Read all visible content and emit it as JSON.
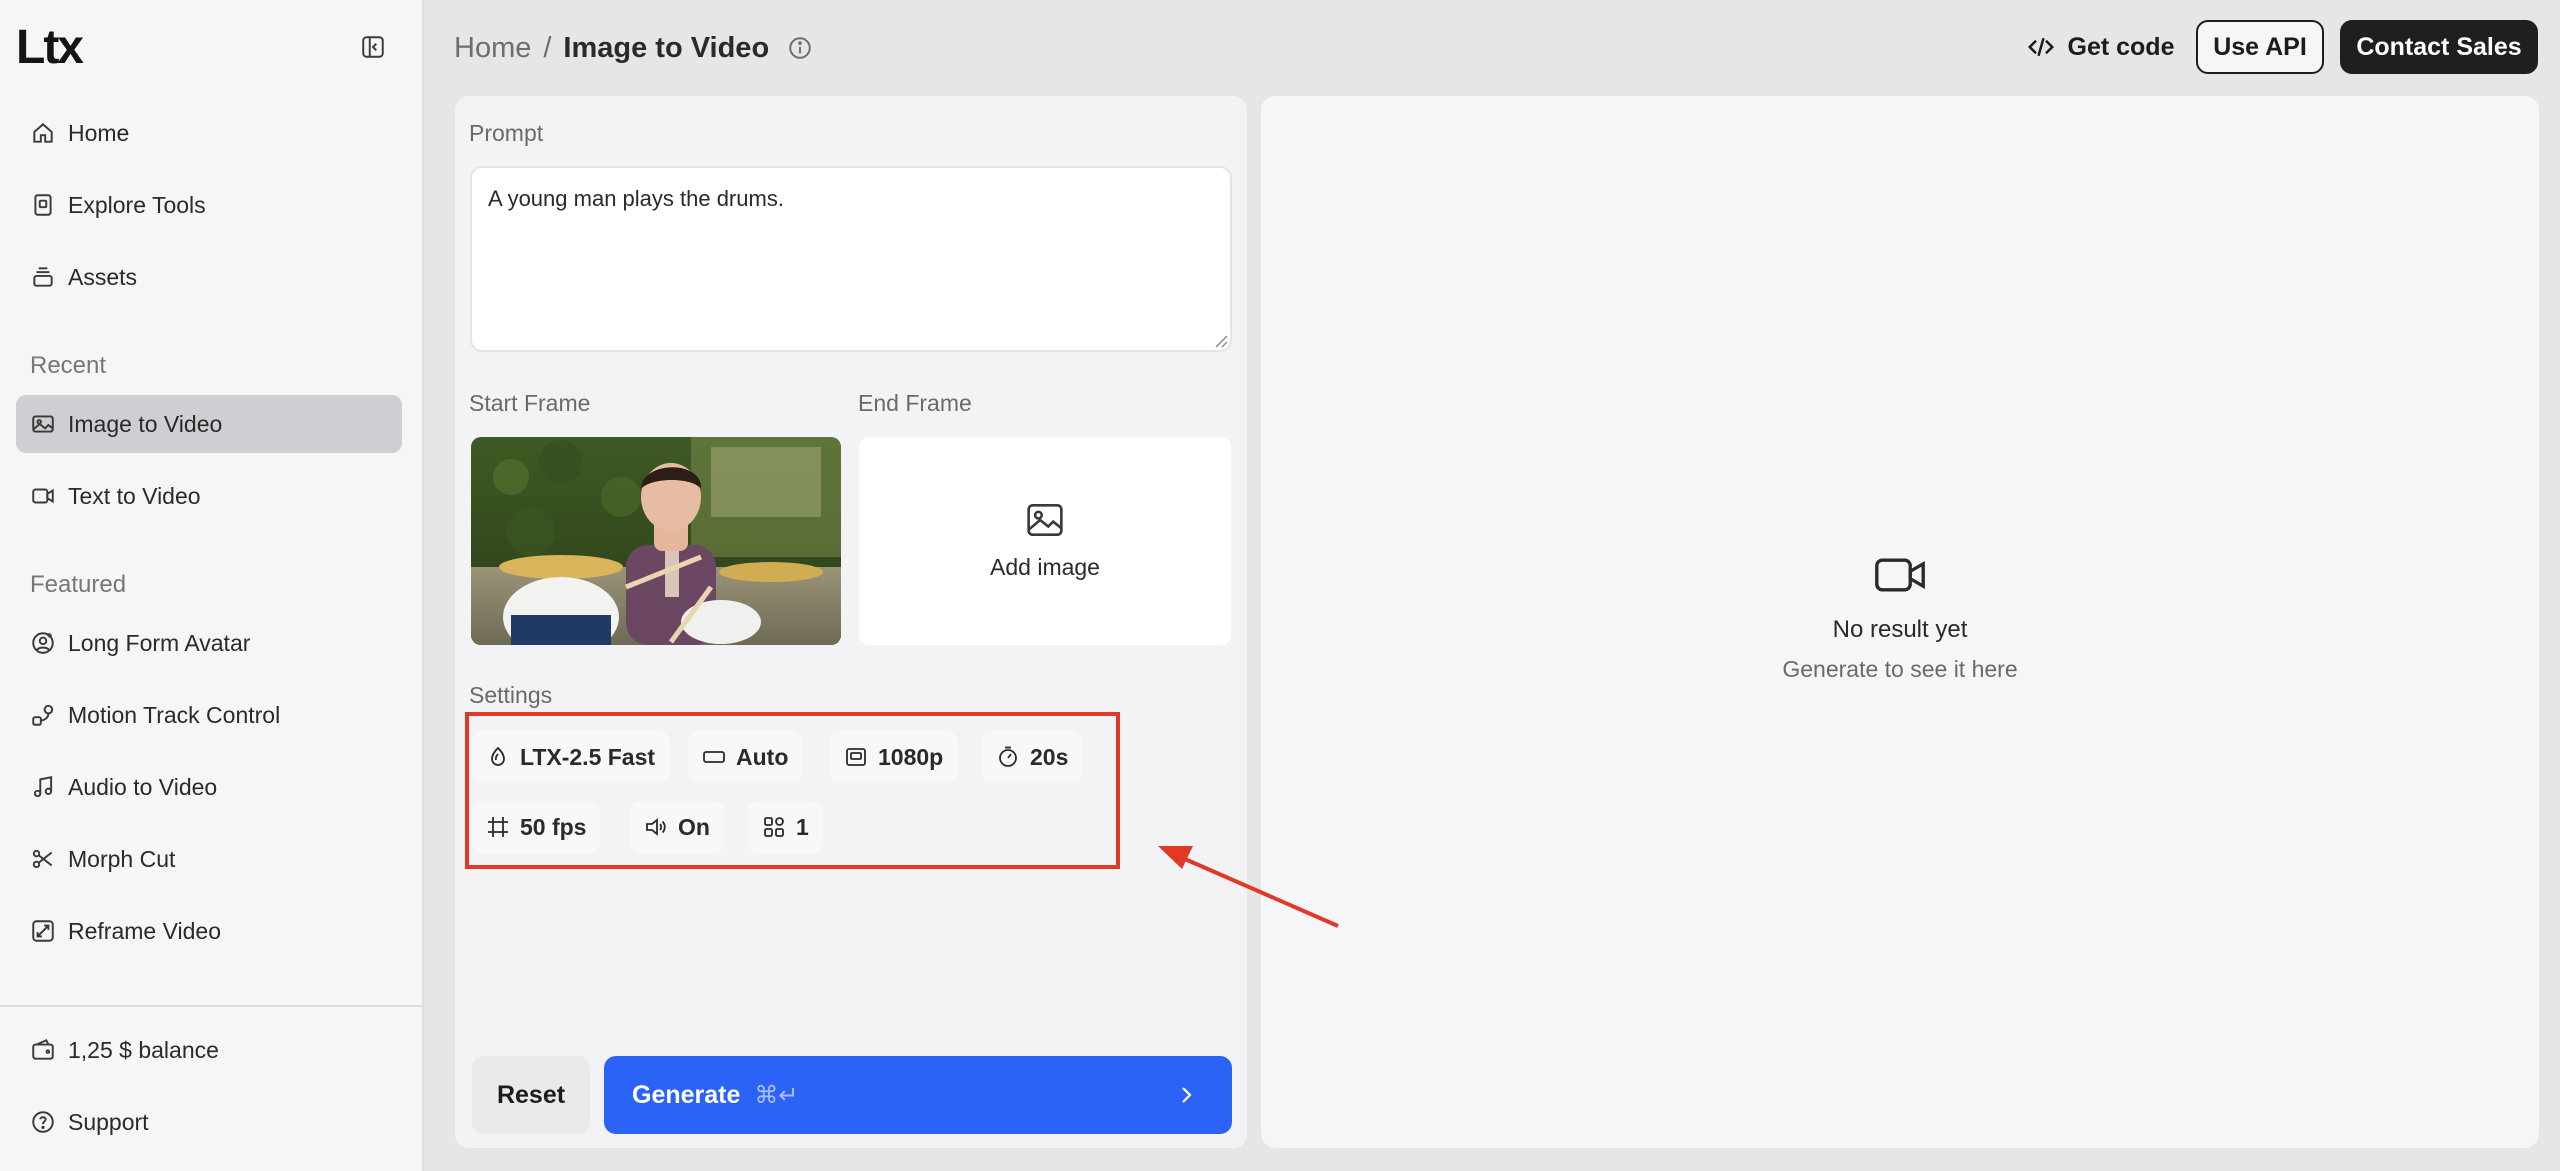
{
  "sidebar": {
    "logo": "Ltx",
    "nav": [
      {
        "label": "Home",
        "icon": "home-icon"
      },
      {
        "label": "Explore Tools",
        "icon": "tools-icon"
      },
      {
        "label": "Assets",
        "icon": "assets-icon"
      }
    ],
    "recent_label": "Recent",
    "recent": [
      {
        "label": "Image to Video",
        "icon": "image-icon",
        "active": true
      },
      {
        "label": "Text to Video",
        "icon": "video-icon"
      }
    ],
    "featured_label": "Featured",
    "featured": [
      {
        "label": "Long Form Avatar",
        "icon": "avatar-icon"
      },
      {
        "label": "Motion Track Control",
        "icon": "motion-icon"
      },
      {
        "label": "Audio to Video",
        "icon": "music-icon"
      },
      {
        "label": "Morph Cut",
        "icon": "scissors-icon"
      },
      {
        "label": "Reframe Video",
        "icon": "reframe-icon"
      }
    ],
    "balance": "1,25 $ balance",
    "support": "Support"
  },
  "header": {
    "breadcrumb_home": "Home",
    "breadcrumb_sep": "/",
    "breadcrumb_current": "Image to Video",
    "get_code": "Get code",
    "use_api": "Use API",
    "contact_sales": "Contact Sales"
  },
  "form": {
    "prompt_label": "Prompt",
    "prompt_value": "A young man plays the drums.",
    "start_frame_label": "Start Frame",
    "end_frame_label": "End Frame",
    "add_image": "Add image",
    "settings_label": "Settings",
    "settings": {
      "model": "LTX-2.5 Fast",
      "aspect": "Auto",
      "resolution": "1080p",
      "duration": "20s",
      "fps": "50 fps",
      "audio": "On",
      "count": "1"
    },
    "reset": "Reset",
    "generate": "Generate",
    "generate_shortcut": "⌘↵"
  },
  "result": {
    "empty_title": "No result yet",
    "empty_subtitle": "Generate to see it here"
  },
  "colors": {
    "accent": "#2b63f6",
    "annotation": "#e03a26",
    "active_nav": "#cfcfd3"
  }
}
